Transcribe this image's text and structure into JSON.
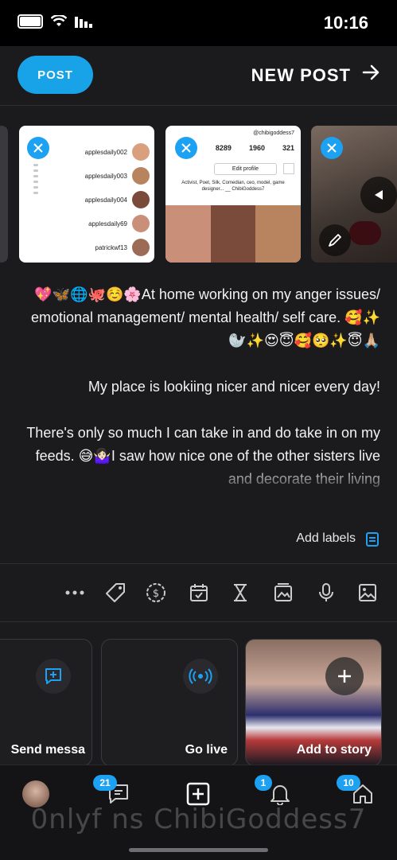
{
  "status_bar": {
    "time": "10:16"
  },
  "header": {
    "post_label": "POST",
    "title": "NEW POST"
  },
  "colors": {
    "accent": "#1da1f2",
    "background": "#1b1b1d"
  },
  "thumbnails": [
    {
      "kind": "profile-list",
      "usernames": [
        "applesdaily002",
        "applesdaily003",
        "applesdaily004",
        "applesdaily69",
        "patrickwf13"
      ]
    },
    {
      "kind": "profile-page",
      "stats": [
        "321",
        "1960",
        "8289"
      ],
      "bio": "Activist, Poet, Silk, Comedian, ceo, model, game designer... __ ChibiGoddess7",
      "edit_profile": "Edit profile",
      "username": "@chibigoddess7"
    },
    {
      "kind": "photo"
    }
  ],
  "caption": {
    "p1": "💖🦋🌐🐙☺️🌸At home working on my anger issues/ emotional management/ mental health/ self care. 🥰✨🦭✨😍😇🥰🥺✨😇🙏🏼",
    "p2": "My place is lookiing nicer and nicer every day!",
    "p3": "There's only so much I can take in and do take in on my feeds. 😅🤷🏻‍♀️I saw how nice one of the other sisters live and decorate their living"
  },
  "labels": {
    "add_labels": "Add labels"
  },
  "toolbar": [
    "image-icon",
    "mic-icon",
    "gallery-icon",
    "hourglass-icon",
    "calendar-icon",
    "dollar-icon",
    "tag-icon",
    "more-icon"
  ],
  "cards": {
    "add_to_story": "Add to story",
    "go_live": "Go live",
    "send_message": "Send messa"
  },
  "tabbar": {
    "home_badge": "10",
    "notifications_badge": "1",
    "messages_badge": "21"
  },
  "watermark": "0nlyf ns ChibiGoddess7"
}
